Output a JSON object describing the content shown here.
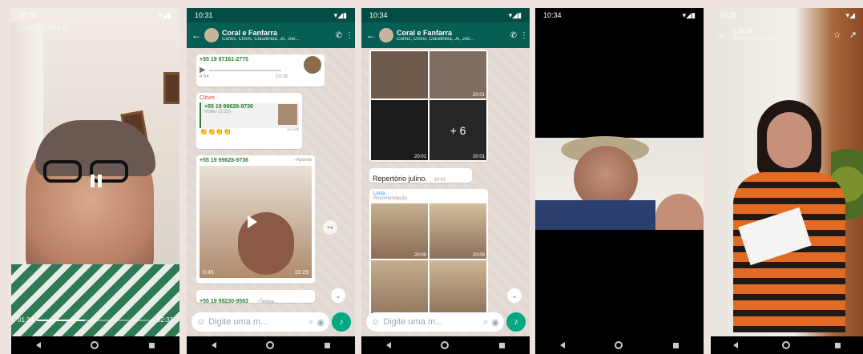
{
  "phones": [
    {
      "status_time": "10:31",
      "video_title": "+55 19 99628-97...",
      "elapsed": "01:34",
      "duration": "02:33",
      "progress": 0.41
    },
    {
      "status_time": "10:31",
      "chat_title": "Coral e Fanfarra",
      "chat_subtitle": "Carlos, Clóvis, Claudinéia, Jo, Joe...",
      "messages": [
        {
          "sender": "+55 19 97161-2775",
          "detail": "4:54",
          "time": "10:16"
        },
        {
          "sender": "Clóvis",
          "quoted_sender": "+55 19 99628-9736",
          "quoted_text": "Vídeo (2:33)",
          "text": "👏👏👏👏",
          "time": "10:28"
        },
        {
          "sender": "+55 19 99628-9736",
          "sender_tag": "~Aparda",
          "video_duration": "0:45",
          "time": "10:29"
        },
        {
          "sender": "+55 19 98230-9563",
          "sender_tag": "~Teresa..."
        }
      ],
      "input_placeholder": "Digite uma m..."
    },
    {
      "status_time": "10:34",
      "chat_title": "Coral e Fanfarra",
      "chat_subtitle": "Carlos, Clóvis, Claudinéia, Jo, Joe...",
      "grid_times": [
        "20:01",
        "20:01",
        "20:01"
      ],
      "more_count": "+ 6",
      "message_text": "Repertório julino.",
      "message_time": "20:02",
      "reply_sender": "Lúcia",
      "reply_text": "Recomendação",
      "grid_times_2": [
        "20:09",
        "20:09"
      ],
      "input_placeholder": "Digite uma m..."
    },
    {
      "status_time": "10:34"
    },
    {
      "status_time": "10:35",
      "contact_name": "Lúcia",
      "contact_date": "30 de junho 19:44"
    }
  ],
  "colors": {
    "whatsapp_header": "#075e54",
    "whatsapp_green": "#00a884",
    "chat_bg": "#e5ddd5"
  }
}
